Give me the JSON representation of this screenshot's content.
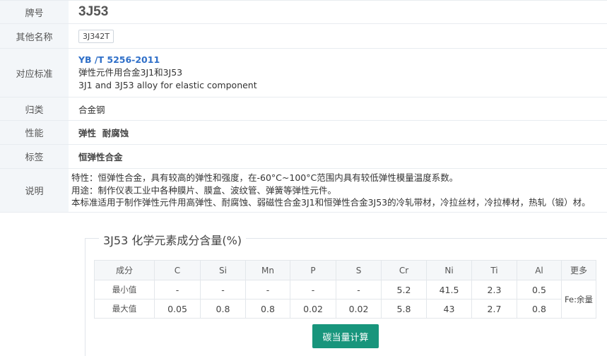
{
  "info": {
    "grade_label": "牌号",
    "grade_value": "3J53",
    "other_names_label": "其他名称",
    "other_names": [
      "3J342T"
    ],
    "standard_label": "对应标准",
    "standard_code": "YB /T 5256-2011",
    "standard_title_cn": "弹性元件用合金3J1和3J53",
    "standard_title_en": "3J1 and 3J53 alloy for elastic component",
    "category_label": "归类",
    "category_value": "合金钢",
    "properties_label": "性能",
    "properties_value": "弹性  耐腐蚀",
    "tags_label": "标签",
    "tags_value": "恒弹性合金",
    "description_label": "说明",
    "description_lines": [
      "特性：恒弹性合金，具有较高的弹性和强度，在-60°C~100°C范围内具有较低弹性模量温度系数。",
      "用途：制作仪表工业中各种膜片、膜盒、波纹管、弹簧等弹性元件。",
      "本标准适用于制作弹性元件用高弹性、耐腐蚀、弱磁性合金3J1和恒弹性合金3J53的冷轧带材，冷拉丝材，冷拉棒材，热轧（锻）材。"
    ]
  },
  "chemistry": {
    "title": "3J53 化学元素成分含量(%)",
    "headers": [
      "成分",
      "C",
      "Si",
      "Mn",
      "P",
      "S",
      "Cr",
      "Ni",
      "Ti",
      "Al",
      "更多"
    ],
    "min_row": [
      "最小值",
      "-",
      "-",
      "-",
      "-",
      "-",
      "5.2",
      "41.5",
      "2.3",
      "0.5"
    ],
    "max_row": [
      "最大值",
      "0.05",
      "0.8",
      "0.8",
      "0.02",
      "0.02",
      "5.8",
      "43",
      "2.7",
      "0.8"
    ],
    "more_value": "Fe:余量",
    "calc_button": "碳当量计算"
  }
}
